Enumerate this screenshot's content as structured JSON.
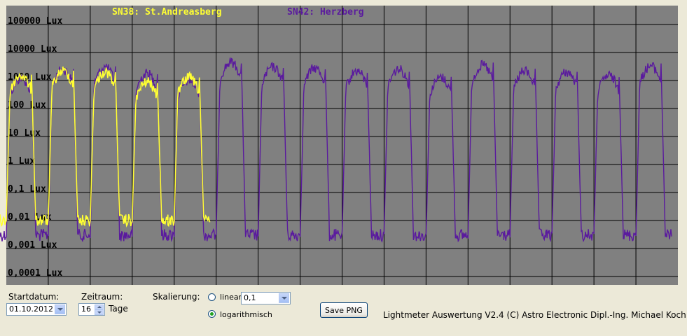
{
  "chart_data": {
    "type": "line",
    "legend": [
      {
        "name": "SN38: St.Andreasberg",
        "color": "#ffff33"
      },
      {
        "name": "SN42: Herzberg",
        "color": "#5a1a9e"
      }
    ],
    "y_scale": "log",
    "y_ticks": [
      "100000 Lux",
      "10000 Lux",
      "1000 Lux",
      "100 Lux",
      "10 Lux",
      "1 Lux",
      "0,1 Lux",
      "0,01 Lux",
      "0,001 Lux",
      "0,0001 Lux"
    ],
    "ylim": [
      0.0001,
      100000
    ],
    "x_days": 16,
    "grid": true,
    "series": [
      {
        "name": "SN38: St.Andreasberg",
        "color": "#ffff33",
        "days": 5,
        "day_peak_lux": [
          1500,
          2200,
          2000,
          900,
          1300
        ],
        "night_lux": 0.01
      },
      {
        "name": "SN42: Herzberg",
        "color": "#5a1a9e",
        "days": 16,
        "day_peak_lux": [
          1200,
          2500,
          3000,
          1800,
          1000,
          4500,
          3000,
          2800,
          2200,
          2500,
          1300,
          3500,
          2200,
          2000,
          1500,
          3300
        ],
        "night_lux": 0.003
      }
    ]
  },
  "controls": {
    "startdatum_label": "Startdatum:",
    "startdatum_value": "01.10.2012",
    "zeitraum_label": "Zeitraum:",
    "zeitraum_value": "16",
    "tage_label": "Tage",
    "skalierung_label": "Skalierung:",
    "linear_label": "linear",
    "linear_value": "0,1",
    "log_label": "logarithmisch",
    "save_button": "Save PNG",
    "footer": "Lightmeter Auswertung V2.4  (C) Astro Electronic Dipl.-Ing. Michael Koch"
  },
  "colors": {
    "plot_bg": "#808080",
    "grid": "#000000",
    "series1": "#ffff33",
    "series2": "#5a1a9e"
  }
}
